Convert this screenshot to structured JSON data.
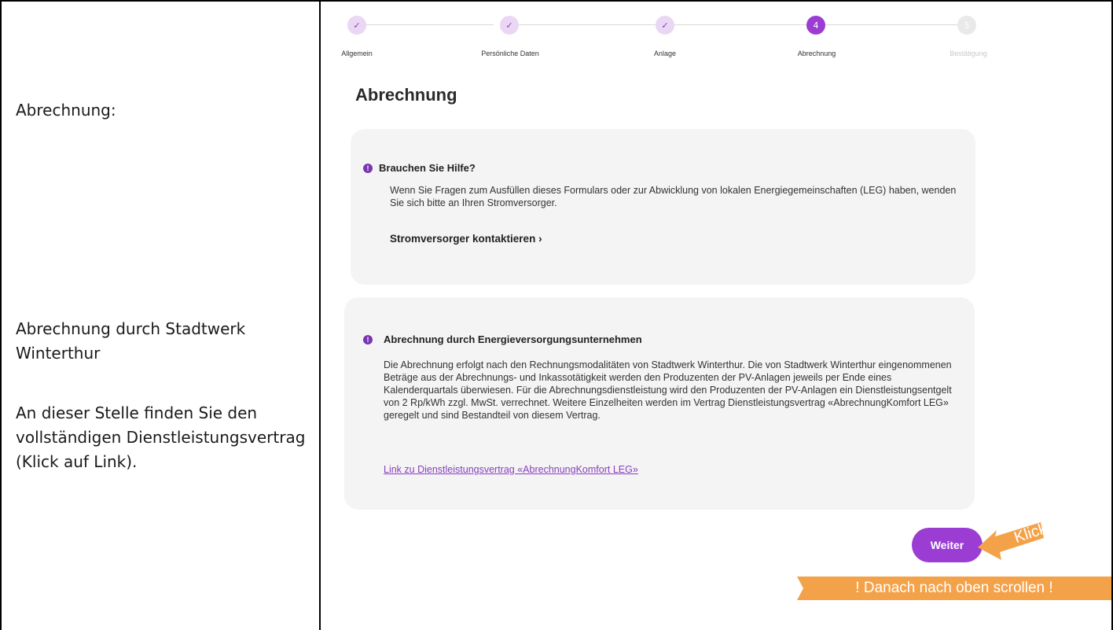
{
  "left_column": {
    "label_1": "Abrechnung:",
    "label_2": "Abrechnung durch Stadtwerk Winterthur",
    "label_3": "An dieser Stelle finden Sie den vollständigen Dienstleistungsvertrag (Klick auf Link)."
  },
  "stepper": {
    "steps": [
      {
        "number": "✓",
        "label": "Allgemein",
        "state": "done"
      },
      {
        "number": "✓",
        "label": "Persönliche Daten",
        "state": "done"
      },
      {
        "number": "✓",
        "label": "Anlage",
        "state": "done"
      },
      {
        "number": "4",
        "label": "Abrechnung",
        "state": "active"
      },
      {
        "number": "5",
        "label": "Bestätigung",
        "state": "todo"
      }
    ]
  },
  "page": {
    "title": "Abrechnung"
  },
  "help_card": {
    "info_icon": "info-icon",
    "heading": "Brauchen Sie Hilfe?",
    "body": "Wenn Sie Fragen zum Ausfüllen dieses Formulars oder zur Abwicklung von lokalen Energiegemeinschaften (LEG) haben, wenden Sie sich bitte an Ihren Stromversorger.",
    "link": "Stromversorger kontaktieren ›"
  },
  "billing_card": {
    "info_icon": "info-icon",
    "heading": "Abrechnung durch Energieversorgungsunternehmen",
    "body": "Die Abrechnung erfolgt nach den Rechnungsmodalitäten von Stadtwerk Winterthur. Die von Stadtwerk Winterthur eingenommenen Beträge aus der Abrechnungs- und Inkassotätigkeit werden den Produzenten der PV-Anlagen jeweils per Ende eines Kalenderquartals überwiesen. Für die Abrechnungsdienstleistung wird den Produzenten der PV-Anlagen ein Dienstleistungsentgelt von 2 Rp/kWh zzgl. MwSt. verrechnet. Weitere Einzelheiten werden im Vertrag Dienstleistungsvertrag «AbrechnungKomfort LEG» geregelt und sind Bestandteil von diesem Vertrag.",
    "link": "Link zu Dienstleistungsvertrag «AbrechnungKomfort LEG»"
  },
  "actions": {
    "next_label": "Weiter",
    "callout_label": "Klick",
    "banner": "! Danach nach oben scrollen !"
  },
  "colors": {
    "accent": "#9b3dd3",
    "callout": "#f4a249",
    "card": "#f4f4f4"
  }
}
